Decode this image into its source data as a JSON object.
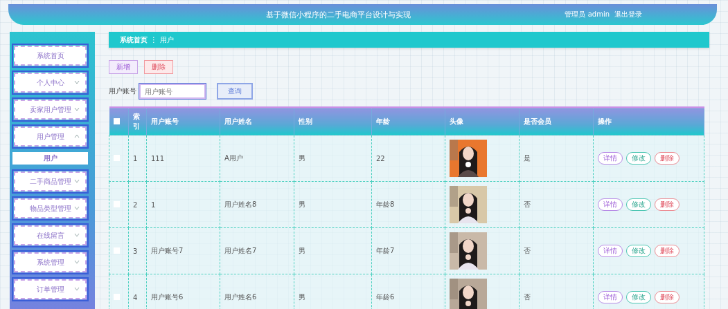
{
  "header": {
    "title": "基于微信小程序的二手电商平台设计与实现",
    "user": "管理员 admin",
    "logout": "退出登录"
  },
  "sidebar": {
    "items": [
      {
        "label": "系统首页",
        "kind": "link"
      },
      {
        "label": "个人中心",
        "kind": "group",
        "expanded": false
      },
      {
        "label": "卖家用户管理",
        "kind": "group",
        "expanded": false
      },
      {
        "label": "用户管理",
        "kind": "group",
        "expanded": true,
        "children": [
          {
            "label": "用户",
            "selected": true
          }
        ]
      },
      {
        "label": "二手商品管理",
        "kind": "group",
        "expanded": false
      },
      {
        "label": "物品类型管理",
        "kind": "group",
        "expanded": false
      },
      {
        "label": "在线留言",
        "kind": "group",
        "expanded": false
      },
      {
        "label": "系统管理",
        "kind": "group",
        "expanded": false
      },
      {
        "label": "订单管理",
        "kind": "group",
        "expanded": false
      }
    ]
  },
  "breadcrumb": {
    "home": "系统首页",
    "separator": "⋮",
    "current": "用户"
  },
  "actions": {
    "add": "新增",
    "delete": "删除"
  },
  "search": {
    "label": "用户账号",
    "placeholder": "用户账号",
    "button": "查询"
  },
  "table": {
    "all_checked": false,
    "columns": [
      "索引",
      "用户账号",
      "用户姓名",
      "性别",
      "年龄",
      "头像",
      "是否会员",
      "操作"
    ],
    "rows": [
      {
        "index": "1",
        "account": "111",
        "name": "A用户",
        "sex": "男",
        "age": "22",
        "avatar": {
          "kind": "picture"
        },
        "member": "是",
        "checked": false,
        "ops": [
          "详情",
          "修改",
          "删除"
        ]
      },
      {
        "index": "2",
        "account": "1",
        "name": "用户姓名8",
        "sex": "男",
        "age": "年龄8",
        "avatar": {
          "kind": "picture"
        },
        "member": "否",
        "checked": false,
        "ops": [
          "详情",
          "修改",
          "删除"
        ]
      },
      {
        "index": "3",
        "account": "用户账号7",
        "name": "用户姓名7",
        "sex": "男",
        "age": "年龄7",
        "avatar": {
          "kind": "picture"
        },
        "member": "否",
        "checked": false,
        "ops": [
          "详情",
          "修改",
          "删除"
        ]
      },
      {
        "index": "4",
        "account": "用户账号6",
        "name": "用户姓名6",
        "sex": "男",
        "age": "年龄6",
        "avatar": {
          "kind": "picture"
        },
        "member": "否",
        "checked": false,
        "ops": [
          "详情",
          "修改",
          "删除"
        ]
      }
    ]
  }
}
